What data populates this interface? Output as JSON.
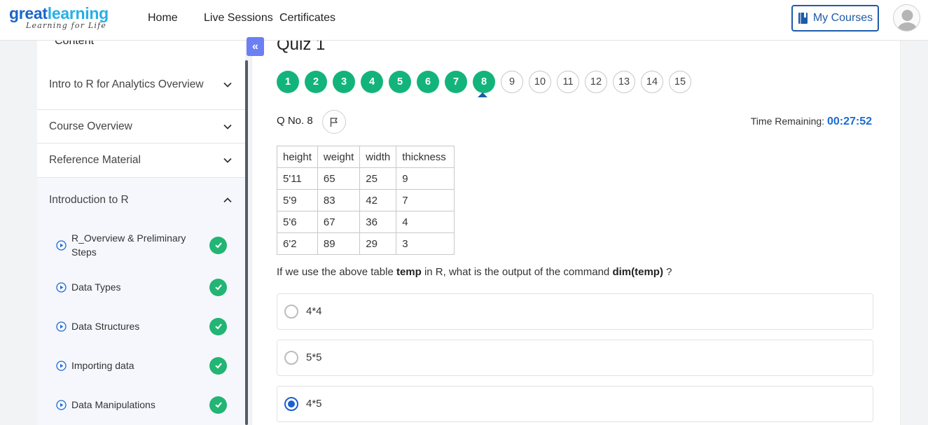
{
  "brand": {
    "logo_part1": "great",
    "logo_part2": "learning",
    "tagline": "Learning for Life"
  },
  "nav": {
    "home": "Home",
    "live_sessions": "Live Sessions",
    "certificates": "Certificates",
    "my_courses": "My Courses"
  },
  "sidebar": {
    "content_label": "Content",
    "collapse_icon": "«",
    "sections": [
      {
        "title": "Intro to R for Analytics Overview",
        "icon": "chevron-down-icon"
      },
      {
        "title": "Course Overview",
        "icon": "chevron-down-icon"
      },
      {
        "title": "Reference Material",
        "icon": "chevron-down-icon"
      },
      {
        "title": "Introduction to R",
        "icon": "chevron-up-icon"
      }
    ],
    "lessons": [
      {
        "title": "R_Overview & Preliminary Steps",
        "completed": true
      },
      {
        "title": "Data Types",
        "completed": true
      },
      {
        "title": "Data Structures",
        "completed": true
      },
      {
        "title": "Importing data",
        "completed": true
      },
      {
        "title": "Data Manipulations",
        "completed": true
      }
    ]
  },
  "quiz": {
    "title": "Quiz 1",
    "questions": [
      "1",
      "2",
      "3",
      "4",
      "5",
      "6",
      "7",
      "8",
      "9",
      "10",
      "11",
      "12",
      "13",
      "14",
      "15"
    ],
    "completed_count": 8,
    "current": 8,
    "qno_label": "Q No. 8",
    "time_label": "Time Remaining:",
    "time_value": "00:27:52",
    "table": {
      "headers": [
        "height",
        "weight",
        "width",
        "thickness"
      ],
      "rows": [
        [
          "5'11",
          "65",
          "25",
          "9"
        ],
        [
          "5'9",
          "83",
          "42",
          "7"
        ],
        [
          "5'6",
          "67",
          "36",
          "4"
        ],
        [
          "6'2",
          "89",
          "29",
          "3"
        ]
      ]
    },
    "question": {
      "part1": "If we use the above table ",
      "bold1": "temp",
      "part2": " in R, what is the output of the command ",
      "bold2": "dim(temp)",
      "part3": " ?"
    },
    "options": [
      {
        "label": "4*4",
        "selected": false
      },
      {
        "label": "5*5",
        "selected": false
      },
      {
        "label": "4*5",
        "selected": true
      }
    ]
  },
  "colors": {
    "done": "#13b47c",
    "accent": "#1c6bd3",
    "brand_blue": "#1b65c9",
    "collapse": "#6c7ff2"
  }
}
